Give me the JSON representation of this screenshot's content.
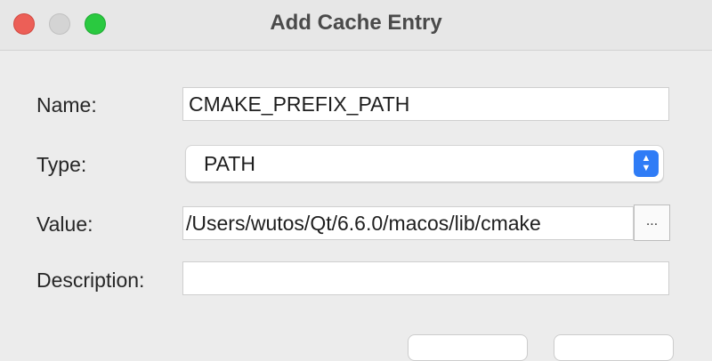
{
  "window": {
    "title": "Add Cache Entry"
  },
  "form": {
    "name_label": "Name:",
    "name_value": "CMAKE_PREFIX_PATH",
    "type_label": "Type:",
    "type_value": "PATH",
    "value_label": "Value:",
    "value_value": "/Users/wutos/Qt/6.6.0/macos/lib/cmake",
    "browse_label": "...",
    "description_label": "Description:",
    "description_value": ""
  },
  "icons": {
    "stepper": "chevron-up-down-icon"
  },
  "colors": {
    "accent": "#2f7cf6",
    "close": "#ec5f57",
    "zoom": "#2ac940"
  }
}
